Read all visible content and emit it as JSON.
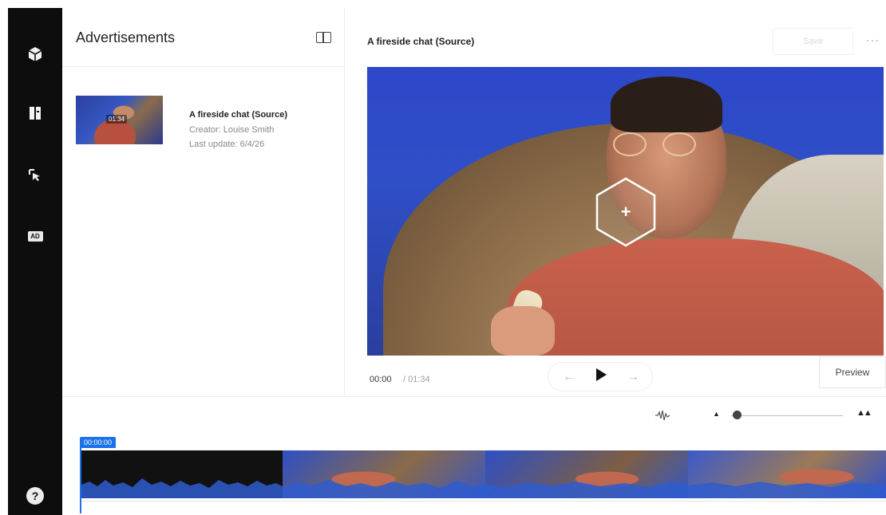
{
  "rail": {
    "items": [
      {
        "icon": "cube-icon"
      },
      {
        "icon": "library-book-icon"
      },
      {
        "icon": "cursor-click-icon"
      },
      {
        "icon": "ad-icon",
        "label": "AD"
      }
    ],
    "help": {
      "icon": "help-icon",
      "label": "?"
    }
  },
  "library": {
    "title": "Advertisements",
    "asset": {
      "duration": "01:34",
      "title": "A fireside chat (Source)",
      "creator": "Creator: Louise Smith",
      "updated": "Last update: 6/4/26"
    }
  },
  "preview": {
    "title": "A fireside chat (Source)",
    "save_label": "Save",
    "more_label": "···",
    "time_current": "00:00",
    "time_separator": "/",
    "time_total": "01:34",
    "back_label": "←",
    "forward_label": "→",
    "preview_label": "Preview",
    "hotspot_label": "+"
  },
  "timeline": {
    "timecode": "00:00:00",
    "zoom_out_label": "▲",
    "zoom_in_label": "▲▲",
    "zoom_level": 0.05
  },
  "colors": {
    "rail": "#0d0d0d",
    "accent": "#1a73e8",
    "video_blue": "#2f4fc7"
  }
}
